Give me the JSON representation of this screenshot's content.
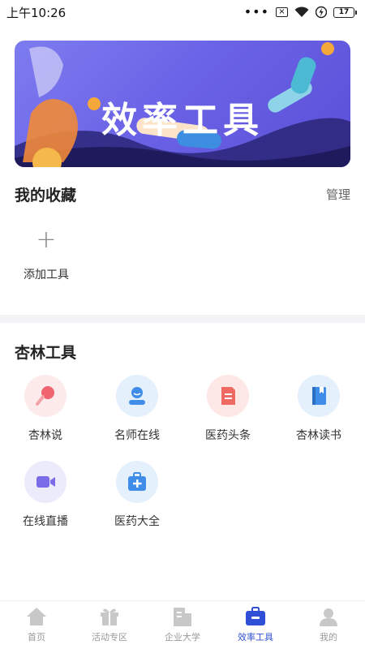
{
  "status": {
    "time": "上午10:26",
    "battery": "17"
  },
  "banner": {
    "title": "效率工具"
  },
  "favorites": {
    "title": "我的收藏",
    "manage": "管理",
    "add_label": "添加工具"
  },
  "tools": {
    "title": "杏林工具",
    "items": [
      {
        "label": "杏林说",
        "icon": "mic-icon",
        "color": "#f06470",
        "bg": "#fdeaea"
      },
      {
        "label": "名师在线",
        "icon": "teacher-icon",
        "color": "#3f8de8",
        "bg": "#e4f0fc"
      },
      {
        "label": "医药头条",
        "icon": "news-icon",
        "color": "#ef6a62",
        "bg": "#fde8e6"
      },
      {
        "label": "杏林读书",
        "icon": "book-icon",
        "color": "#3f8de8",
        "bg": "#e4f0fc"
      },
      {
        "label": "在线直播",
        "icon": "video-icon",
        "color": "#7a6be8",
        "bg": "#ecebfc"
      },
      {
        "label": "医药大全",
        "icon": "medkit-icon",
        "color": "#3f8de8",
        "bg": "#e4f0fc"
      }
    ]
  },
  "nav": {
    "items": [
      {
        "label": "首页",
        "icon": "home-icon"
      },
      {
        "label": "活动专区",
        "icon": "gift-icon"
      },
      {
        "label": "企业大学",
        "icon": "building-icon"
      },
      {
        "label": "效率工具",
        "icon": "toolbox-icon",
        "active": true
      },
      {
        "label": "我的",
        "icon": "profile-icon"
      }
    ],
    "active_color": "#2e4fd6",
    "inactive_color": "#c8c8c8"
  }
}
